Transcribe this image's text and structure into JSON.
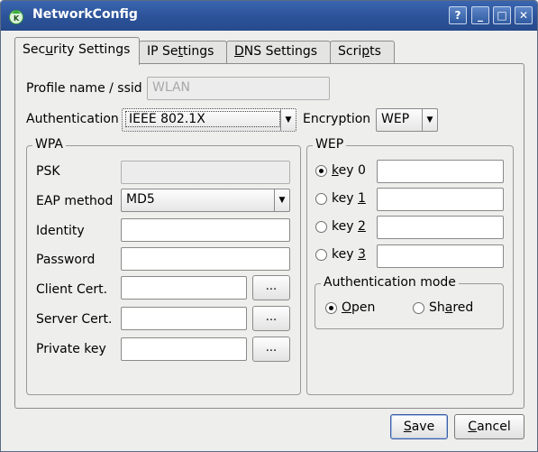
{
  "window": {
    "title": "NetworkConfig",
    "buttons": {
      "help": "?",
      "minimize": "_",
      "maximize": "□",
      "close": "✕"
    }
  },
  "tabs": [
    {
      "label_pre": "Sec",
      "label_u": "u",
      "label_post": "rity Settings"
    },
    {
      "label_pre": "IP Se",
      "label_u": "t",
      "label_post": "tings"
    },
    {
      "label_pre": "",
      "label_u": "D",
      "label_post": "NS Settings"
    },
    {
      "label_pre": "Scri",
      "label_u": "p",
      "label_post": "ts"
    }
  ],
  "security": {
    "profile_label": "Profile name / ssid",
    "profile_value": "WLAN",
    "auth_label": "Authentication",
    "auth_value": "IEEE 802.1X",
    "encryption_label": "Encryption",
    "encryption_value": "WEP"
  },
  "wpa": {
    "title": "WPA",
    "psk_label": "PSK",
    "psk_value": "",
    "eap_label": "EAP method",
    "eap_value": "MD5",
    "identity_label": "Identity",
    "password_label": "Password",
    "client_cert_label": "Client Cert.",
    "server_cert_label": "Server Cert.",
    "private_key_label": "Private key",
    "browse_label": "..."
  },
  "wep": {
    "title": "WEP",
    "keys": [
      {
        "pre": "",
        "u": "k",
        "post": "ey 0",
        "selected": true
      },
      {
        "pre": "key ",
        "u": "1",
        "post": "",
        "selected": false
      },
      {
        "pre": "key ",
        "u": "2",
        "post": "",
        "selected": false
      },
      {
        "pre": "key ",
        "u": "3",
        "post": "",
        "selected": false
      }
    ],
    "auth_mode_title": "Authentication mode",
    "open_u": "O",
    "open_post": "pen",
    "shared_pre": "Sh",
    "shared_u": "a",
    "shared_post": "red"
  },
  "footer": {
    "save_u": "S",
    "save_post": "ave",
    "cancel_u": "C",
    "cancel_post": "ancel"
  },
  "colors": {
    "titlebar": "#2c5298",
    "accent": "#3a5da0"
  }
}
